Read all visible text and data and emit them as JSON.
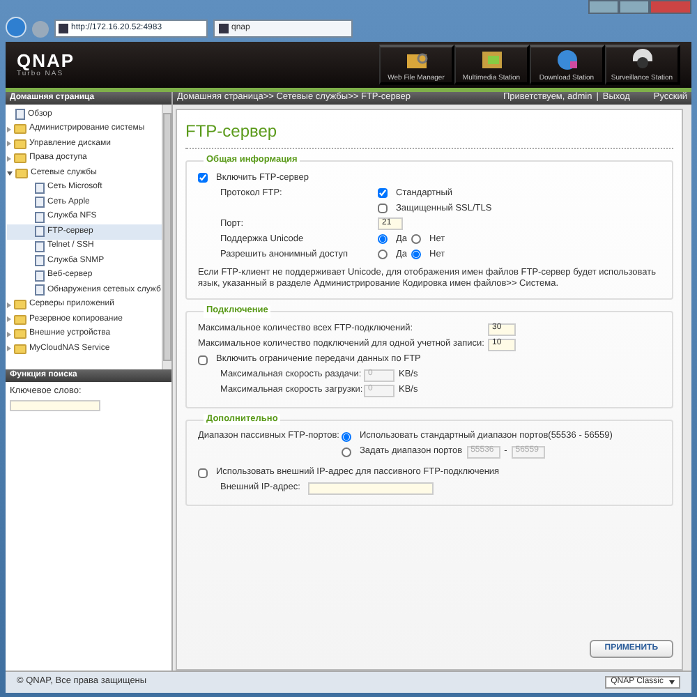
{
  "browser": {
    "address": "http://172.16.20.52:4983",
    "tab": "qnap"
  },
  "header": {
    "logo": "QNAP",
    "subtitle": "Turbo NAS",
    "apps": [
      {
        "label": "Web File Manager",
        "kind": "files"
      },
      {
        "label": "Multimedia Station",
        "kind": "media"
      },
      {
        "label": "Download Station",
        "kind": "download"
      },
      {
        "label": "Surveillance Station",
        "kind": "camera"
      }
    ]
  },
  "sidebar": {
    "title": "Домашняя страница",
    "tree": [
      {
        "label": "Обзор",
        "kind": "page",
        "selected": false
      },
      {
        "label": "Администрирование системы",
        "kind": "folder",
        "expanded": false
      },
      {
        "label": "Управление дисками",
        "kind": "folder",
        "expanded": false
      },
      {
        "label": "Права доступа",
        "kind": "folder",
        "expanded": false
      },
      {
        "label": "Сетевые службы",
        "kind": "folder",
        "expanded": true,
        "children": [
          {
            "label": "Сеть Microsoft",
            "kind": "page",
            "selected": false
          },
          {
            "label": "Сеть Apple",
            "kind": "page",
            "selected": false
          },
          {
            "label": "Служба NFS",
            "kind": "page",
            "selected": false
          },
          {
            "label": "FTP-сервер",
            "kind": "page",
            "selected": true
          },
          {
            "label": "Telnet / SSH",
            "kind": "page",
            "selected": false
          },
          {
            "label": "Служба SNMP",
            "kind": "page",
            "selected": false
          },
          {
            "label": "Веб-сервер",
            "kind": "page",
            "selected": false
          },
          {
            "label": "Обнаружения сетевых служб",
            "kind": "page",
            "selected": false
          }
        ]
      },
      {
        "label": "Серверы приложений",
        "kind": "folder",
        "expanded": false
      },
      {
        "label": "Резервное копирование",
        "kind": "folder",
        "expanded": false
      },
      {
        "label": "Внешние устройства",
        "kind": "folder",
        "expanded": false
      },
      {
        "label": "MyCloudNAS Service",
        "kind": "folder",
        "expanded": false
      }
    ],
    "search": {
      "title": "Функция поиска",
      "label": "Ключевое слово:"
    }
  },
  "topbar": {
    "breadcrumb": "Домашняя страница>> Сетевые службы>> FTP-сервер",
    "welcome": "Приветствуем, admin",
    "separator": "|",
    "logout": "Выход",
    "language": "Русский"
  },
  "page_title": "FTP-сервер",
  "general": {
    "legend": "Общая информация",
    "enable": {
      "label": "Включить FTP-сервер",
      "checked": true
    },
    "protocol_label": "Протокол FTP:",
    "protocols": [
      {
        "label": "Стандартный",
        "checked": true
      },
      {
        "label": "Защищенный SSL/TLS",
        "checked": false
      }
    ],
    "port_label": "Порт:",
    "port": "21",
    "radio_rows": [
      {
        "label": "Поддержка Unicode",
        "options": [
          {
            "label": "Да",
            "selected": true
          },
          {
            "label": "Нет",
            "selected": false
          }
        ]
      },
      {
        "label": "Разрешить анонимный доступ",
        "options": [
          {
            "label": "Да",
            "selected": false
          },
          {
            "label": "Нет",
            "selected": true
          }
        ]
      }
    ],
    "note": "Если FTP-клиент не поддерживает Unicode, для отображения имен файлов FTP-сервер будет использовать язык, указанный в разделе ",
    "note_link": "Администрирование Кодировка имен файлов>> Система."
  },
  "connection": {
    "legend": "Подключение",
    "limits": [
      {
        "label": "Максимальное количество всех FTP-подключений:",
        "value": "30"
      },
      {
        "label": "Максимальное количество подключений для одной учетной записи:",
        "value": "10"
      }
    ],
    "throttle": {
      "label": "Включить ограничение передачи данных по FTP",
      "checked": false
    },
    "speeds": [
      {
        "label": "Максимальная скорость раздачи:",
        "value": "0",
        "unit": "KB/s",
        "disabled": true
      },
      {
        "label": "Максимальная скорость загрузки:",
        "value": "0",
        "unit": "KB/s",
        "disabled": true
      }
    ]
  },
  "advanced": {
    "legend": "Дополнительно",
    "passive_label": "Диапазон пассивных FTP-портов:",
    "passive_options": [
      {
        "label": "Использовать стандартный диапазон портов(55536 - 56559)",
        "selected": true
      },
      {
        "label": "Задать диапазон портов",
        "selected": false,
        "from": "55536",
        "dash": "-",
        "to": "56559",
        "disabled": true
      }
    ],
    "external": {
      "label": "Использовать внешний IP-адрес для пассивного FTP-подключения",
      "checked": false
    },
    "ip_label": "Внешний IP-адрес:"
  },
  "apply": "ПРИМЕНИТЬ",
  "footer": {
    "copyright": "© QNAP, Все права защищены",
    "theme": "QNAP Classic"
  }
}
